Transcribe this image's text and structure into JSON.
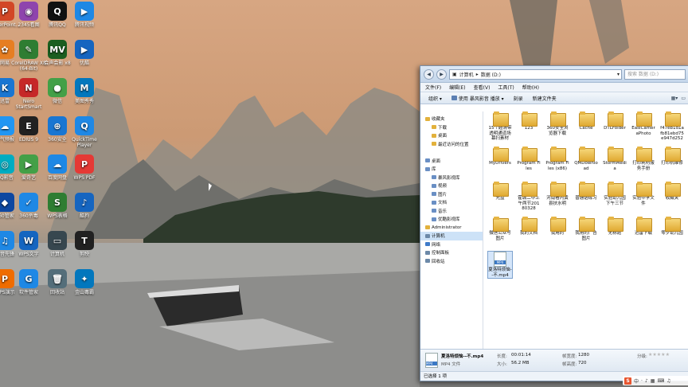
{
  "desktop": {
    "icons": [
      {
        "label": "PowerPoint...",
        "glyph": "P",
        "color": "#d24726"
      },
      {
        "label": "2345看图",
        "glyph": "◉",
        "color": "#8e44ad"
      },
      {
        "label": "腾讯QQ",
        "glyph": "Q",
        "color": "#111"
      },
      {
        "label": "腾讯视频",
        "glyph": "▶",
        "color": "#1e88e5"
      },
      {
        "label": "网易",
        "glyph": "✿",
        "color": "#e67e22"
      },
      {
        "label": "CorelDRAW X8 (64-Bit)",
        "glyph": "✎",
        "color": "#2e7d32"
      },
      {
        "label": "会声会影 x8",
        "glyph": "MV",
        "color": "#1b5e20"
      },
      {
        "label": "优酷",
        "glyph": "▶",
        "color": "#1565c0"
      },
      {
        "label": "迅雷",
        "glyph": "K",
        "color": "#1976d2"
      },
      {
        "label": "Nero StartSmart",
        "glyph": "N",
        "color": "#c62828"
      },
      {
        "label": "微信",
        "glyph": "●",
        "color": "#43a047"
      },
      {
        "label": "美图秀秀",
        "glyph": "M",
        "color": "#0277bd"
      },
      {
        "label": "天气预报",
        "glyph": "☁",
        "color": "#2196f3"
      },
      {
        "label": "EDIUS 9",
        "glyph": "E",
        "color": "#212121"
      },
      {
        "label": "360安全",
        "glyph": "⊕",
        "color": "#1976d2"
      },
      {
        "label": "QuickTime Player",
        "glyph": "Q",
        "color": "#1e88e5"
      },
      {
        "label": "QQ影音",
        "glyph": "◎",
        "color": "#00acc1"
      },
      {
        "label": "爱奇艺",
        "glyph": "▶",
        "color": "#43a047"
      },
      {
        "label": "百度网盘",
        "glyph": "☁",
        "color": "#1e88e5"
      },
      {
        "label": "WPS PDF",
        "glyph": "P",
        "color": "#e53935"
      },
      {
        "label": "360管家",
        "glyph": "◆",
        "color": "#0d47a1"
      },
      {
        "label": "360杀毒",
        "glyph": "✓",
        "color": "#1e88e5"
      },
      {
        "label": "WPS表格",
        "glyph": "S",
        "color": "#2e7d32"
      },
      {
        "label": "酷狗",
        "glyph": "♪",
        "color": "#1565c0"
      },
      {
        "label": "影音先锋",
        "glyph": "♫",
        "color": "#1e88e5"
      },
      {
        "label": "WPS文字",
        "glyph": "W",
        "color": "#1565c0"
      },
      {
        "label": "计算机",
        "glyph": "▭",
        "color": "#37474f"
      },
      {
        "label": "剪映",
        "glyph": "T",
        "color": "#212121"
      },
      {
        "label": "WPS演示",
        "glyph": "P",
        "color": "#ef6c00"
      },
      {
        "label": "软件管家",
        "glyph": "G",
        "color": "#1e88e5"
      },
      {
        "label": "回收站",
        "glyph": "🗑",
        "color": "#546e7a"
      },
      {
        "label": "金山毒霸",
        "glyph": "✦",
        "color": "#0277bd"
      }
    ]
  },
  "explorer": {
    "address": [
      "计算机",
      "数据 (D:)"
    ],
    "search_placeholder": "搜索 数据 (D:)",
    "menu": [
      "文件(F)",
      "编辑(E)",
      "查看(V)",
      "工具(T)",
      "帮助(H)"
    ],
    "toolbar": {
      "organize": "组织 ▾",
      "open_with": "使用 暴风影音 播放 ▾",
      "burn": "刻录",
      "new_folder": "新建文件夹"
    },
    "nav": [
      {
        "label": "收藏夹",
        "type": "fav"
      },
      {
        "label": "下载",
        "type": "fav"
      },
      {
        "label": "桌面",
        "type": "fav"
      },
      {
        "label": "最近访问的位置",
        "type": "fav"
      },
      {
        "label": "",
        "type": "gap"
      },
      {
        "label": "桌面",
        "type": "lib"
      },
      {
        "label": "库",
        "type": "lib"
      },
      {
        "label": "暴风影视库",
        "type": "lib"
      },
      {
        "label": "视频",
        "type": "lib"
      },
      {
        "label": "图片",
        "type": "lib"
      },
      {
        "label": "文档",
        "type": "lib"
      },
      {
        "label": "音乐",
        "type": "lib"
      },
      {
        "label": "优酷影视库",
        "type": "lib"
      },
      {
        "label": "Administrator",
        "type": "fav"
      },
      {
        "label": "计算机",
        "type": "pc",
        "selected": true
      },
      {
        "label": "网络",
        "type": "net"
      },
      {
        "label": "控制面板",
        "type": "pc"
      },
      {
        "label": "回收站",
        "type": "pc"
      }
    ],
    "files": [
      {
        "name": "15个超清带透明通道场幕扫素材",
        "kind": "folder"
      },
      {
        "name": "123",
        "kind": "folder"
      },
      {
        "name": "360安全浏览器下载",
        "kind": "folder"
      },
      {
        "name": "Cache",
        "kind": "folder"
      },
      {
        "name": "DTLFolder",
        "kind": "folder"
      },
      {
        "name": "EasiCameraPhoto",
        "kind": "folder"
      },
      {
        "name": "f47eb1d1afb81ebd75e947d252",
        "kind": "folder"
      },
      {
        "name": "MyDrivers",
        "kind": "folder"
      },
      {
        "name": "Program Files",
        "kind": "folder"
      },
      {
        "name": "Program Files (x86)",
        "kind": "folder"
      },
      {
        "name": "QMDownload",
        "kind": "folder"
      },
      {
        "name": "StormMedia",
        "kind": "folder"
      },
      {
        "name": "打印耗材服务手册",
        "kind": "folder"
      },
      {
        "name": "打印机维修",
        "kind": "folder"
      },
      {
        "name": "光盘",
        "kind": "folder"
      },
      {
        "name": "霍城二中上午两节20180328",
        "kind": "folder"
      },
      {
        "name": "河南看内黄县扶水明",
        "kind": "folder"
      },
      {
        "name": "普通话练习",
        "kind": "folder"
      },
      {
        "name": "实验幼儿园下午三节",
        "kind": "folder"
      },
      {
        "name": "实验中学文件",
        "kind": "folder"
      },
      {
        "name": "收藏夹",
        "kind": "folder"
      },
      {
        "name": "微信公众号图片",
        "kind": "folder"
      },
      {
        "name": "我的文档",
        "kind": "folder"
      },
      {
        "name": "我用的",
        "kind": "folder"
      },
      {
        "name": "我用的广告图片",
        "kind": "folder"
      },
      {
        "name": "无标题",
        "kind": "folder"
      },
      {
        "name": "迅雷下载",
        "kind": "folder"
      },
      {
        "name": "零夕幼儿园",
        "kind": "folder"
      },
      {
        "name": "夏洛特烦恼--不.mp4",
        "kind": "mp4",
        "selected": true
      }
    ],
    "details": {
      "name": "夏洛特烦恼--不.mp4",
      "type": "MP4 文件",
      "length_label": "长度:",
      "length": "00:01:14",
      "size_label": "大小:",
      "size": "56.2 MB",
      "width_label": "帧宽度:",
      "width": "1280",
      "height_label": "帧高度:",
      "height": "720",
      "rating_label": "分级:"
    },
    "status": "已选择 1 项"
  },
  "tray": {
    "ime": "S",
    "items": [
      "中",
      "·",
      "♪",
      "▦",
      "⌨",
      "♫"
    ]
  }
}
